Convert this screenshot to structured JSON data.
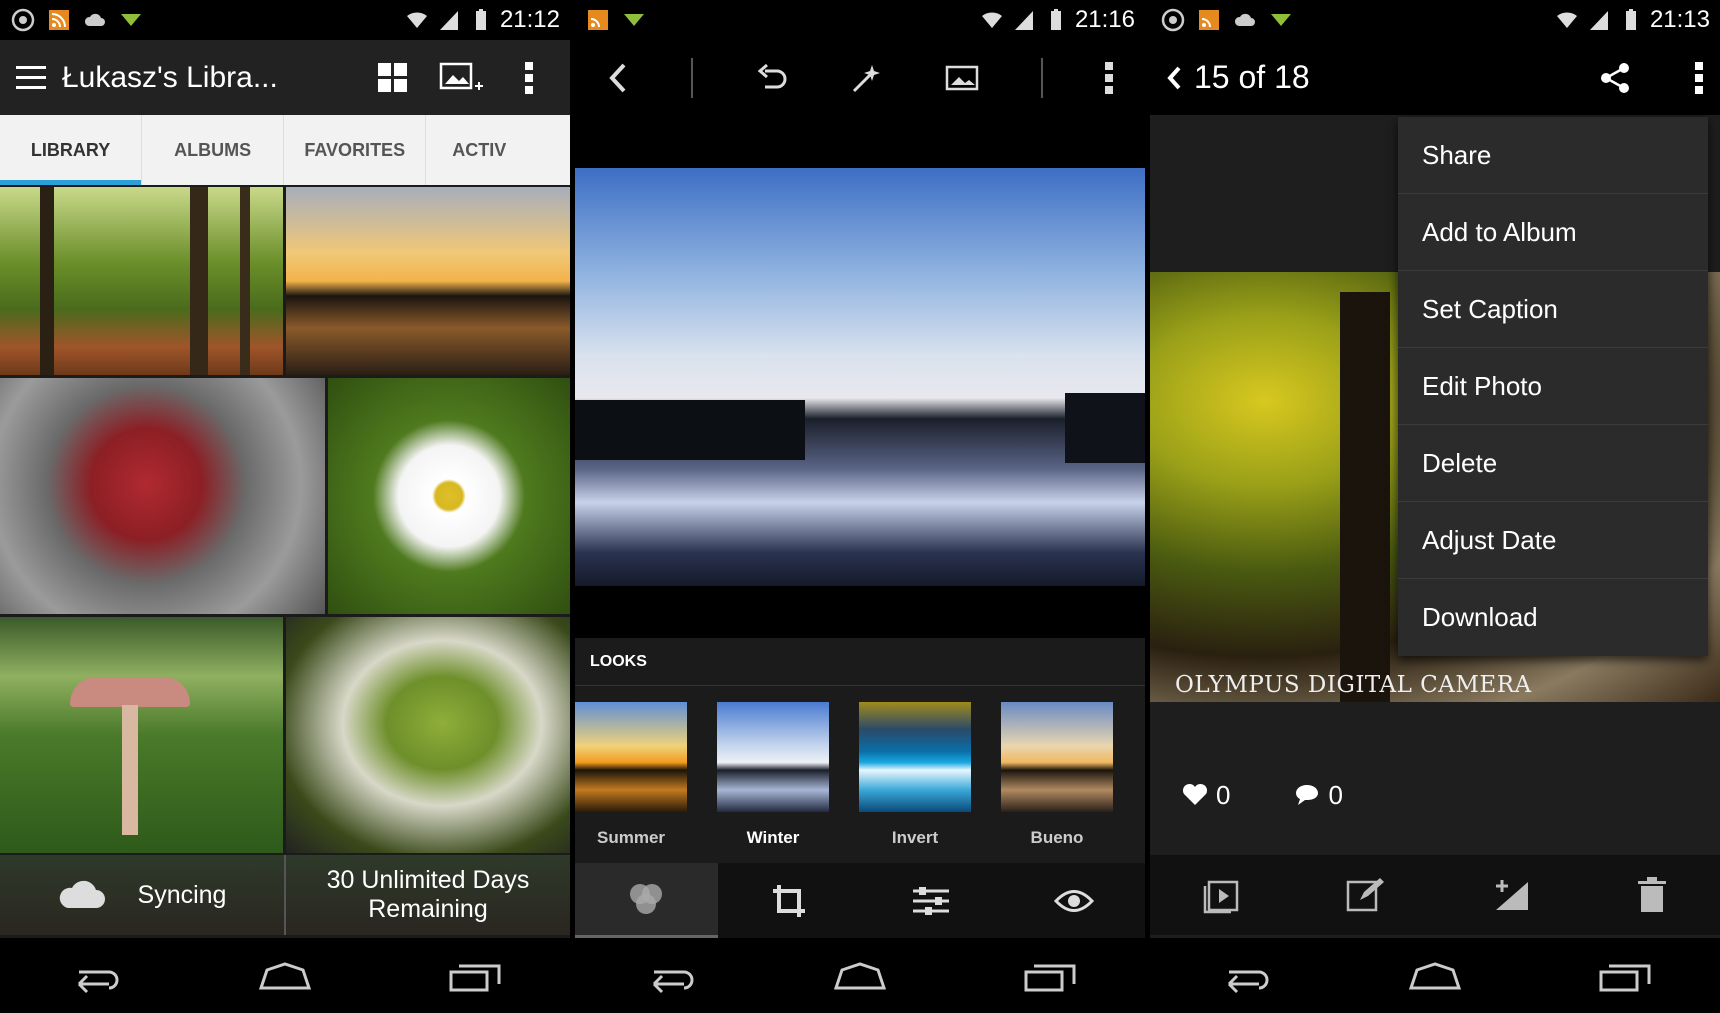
{
  "screen1": {
    "status": {
      "time": "21:12"
    },
    "title": "Łukasz's Libra...",
    "tabs": [
      {
        "label": "LIBRARY",
        "active": true
      },
      {
        "label": "ALBUMS",
        "active": false
      },
      {
        "label": "FAVORITES",
        "active": false
      },
      {
        "label": "ACTIV",
        "active": false
      }
    ],
    "footer": {
      "sync_label": "Syncing",
      "trial_label": "30 Unlimited Days Remaining"
    }
  },
  "screen2": {
    "status": {
      "time": "21:16"
    },
    "looks_title": "LOOKS",
    "looks": [
      {
        "label": "Summer",
        "selected": false
      },
      {
        "label": "Winter",
        "selected": true
      },
      {
        "label": "Invert",
        "selected": false
      },
      {
        "label": "Bueno",
        "selected": false
      }
    ]
  },
  "screen3": {
    "status": {
      "time": "21:13"
    },
    "counter": "15 of 18",
    "menu": [
      "Share",
      "Add to Album",
      "Set Caption",
      "Edit Photo",
      "Delete",
      "Adjust Date",
      "Download"
    ],
    "caption": "OLYMPUS DIGITAL CAMERA",
    "likes": "0",
    "comments": "0"
  },
  "colors": {
    "accent": "#2a9fd8",
    "tab_bg": "#f2f2f2",
    "appbar": "#222222"
  }
}
